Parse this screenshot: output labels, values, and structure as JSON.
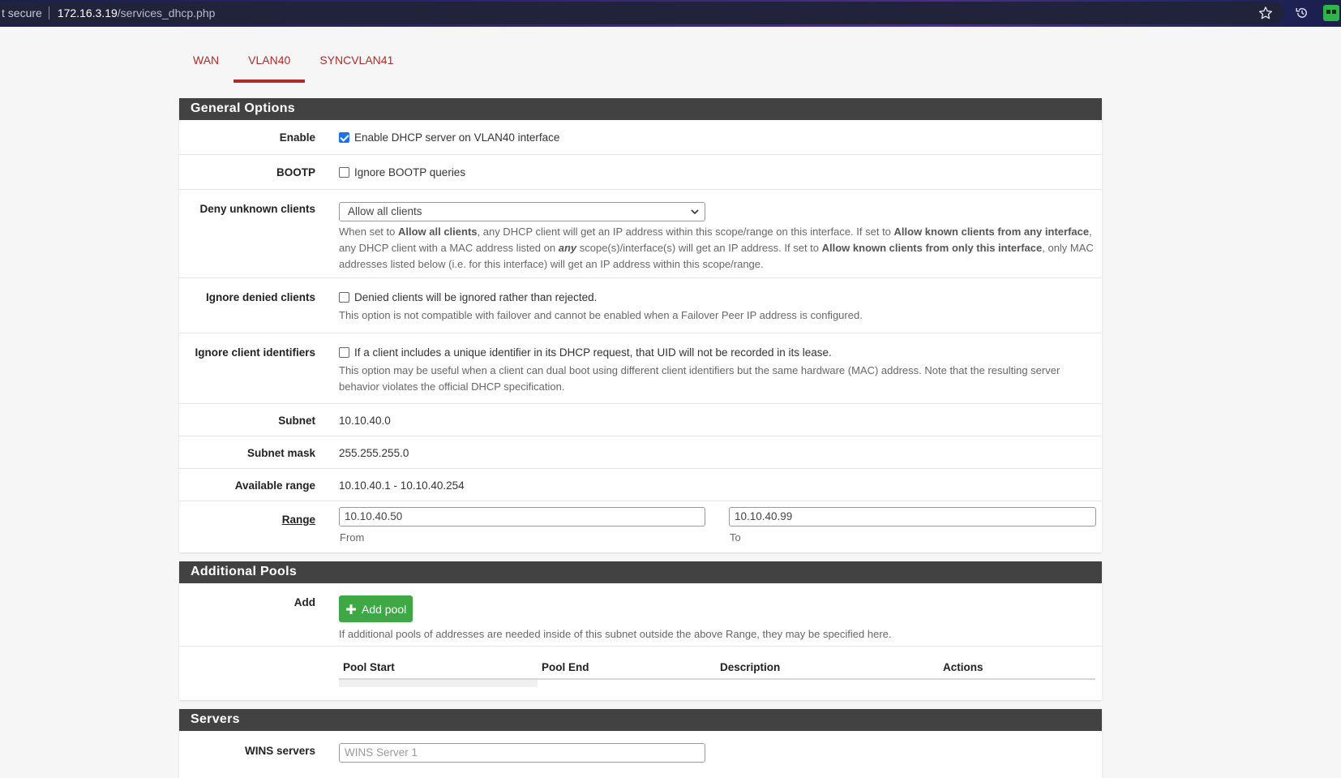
{
  "browser": {
    "security": "t secure",
    "url_host": "172.16.3.19",
    "url_path": "/services_dhcp.php"
  },
  "tabs": [
    {
      "label": "WAN",
      "active": false
    },
    {
      "label": "VLAN40",
      "active": true
    },
    {
      "label": "SYNCVLAN41",
      "active": false
    }
  ],
  "general": {
    "heading": "General Options",
    "enable": {
      "label": "Enable",
      "checkbox_label": "Enable DHCP server on VLAN40 interface",
      "checked": true
    },
    "bootp": {
      "label": "BOOTP",
      "checkbox_label": "Ignore BOOTP queries",
      "checked": false
    },
    "deny_unknown": {
      "label": "Deny unknown clients",
      "selected": "Allow all clients",
      "help": {
        "p1": "When set to ",
        "b1": "Allow all clients",
        "p2": ", any DHCP client will get an IP address within this scope/range on this interface. If set to ",
        "b2": "Allow known clients from any interface",
        "p3": ", any DHCP client with a MAC address listed on ",
        "b3": "any",
        "p4": " scope(s)/interface(s) will get an IP address. If set to ",
        "b4": "Allow known clients from only this interface",
        "p5": ", only MAC addresses listed below (i.e. for this interface) will get an IP address within this scope/range."
      }
    },
    "ignore_denied": {
      "label": "Ignore denied clients",
      "checkbox_label": "Denied clients will be ignored rather than rejected.",
      "checked": false,
      "help": "This option is not compatible with failover and cannot be enabled when a Failover Peer IP address is configured."
    },
    "ignore_client_ids": {
      "label": "Ignore client identifiers",
      "checkbox_label": "If a client includes a unique identifier in its DHCP request, that UID will not be recorded in its lease.",
      "checked": false,
      "help": "This option may be useful when a client can dual boot using different client identifiers but the same hardware (MAC) address. Note that the resulting server behavior violates the official DHCP specification."
    },
    "subnet": {
      "label": "Subnet",
      "value": "10.10.40.0"
    },
    "subnet_mask": {
      "label": "Subnet mask",
      "value": "255.255.255.0"
    },
    "available_range": {
      "label": "Available range",
      "value": "10.10.40.1 - 10.10.40.254"
    },
    "range": {
      "label": "Range",
      "from_value": "10.10.40.50",
      "from_label": "From",
      "to_value": "10.10.40.99",
      "to_label": "To"
    }
  },
  "pools": {
    "heading": "Additional Pools",
    "add_label": "Add",
    "add_button": "Add pool",
    "help": "If additional pools of addresses are needed inside of this subnet outside the above Range, they may be specified here.",
    "columns": [
      "Pool Start",
      "Pool End",
      "Description",
      "Actions"
    ]
  },
  "servers": {
    "heading": "Servers",
    "wins_label": "WINS servers",
    "wins_placeholder": "WINS Server 1"
  },
  "colors": {
    "accent": "#b02a2a",
    "panel_heading": "#424242",
    "success": "#3ea845"
  }
}
